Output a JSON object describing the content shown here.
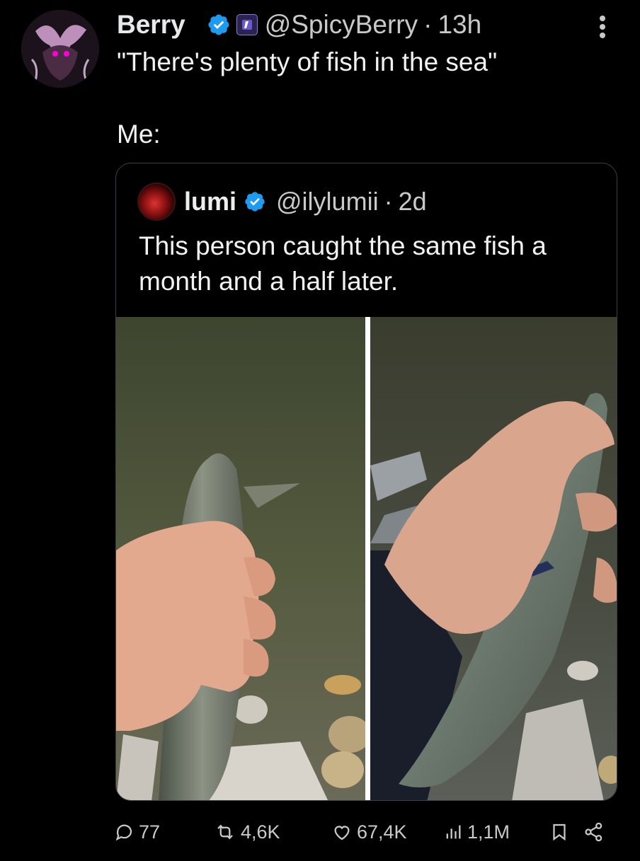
{
  "tweet": {
    "author_name": "Berry",
    "handle": "@SpicyBerry",
    "separator": "·",
    "time": "13h",
    "text_line1": "\"There's plenty of fish in the sea\"",
    "text_line2": "Me:",
    "icons": {
      "verified": "verified-badge-icon",
      "affiliate": "affiliate-badge-icon",
      "more": "more-vertical-icon"
    }
  },
  "quote": {
    "author_name": "lumi",
    "handle": "@ilylumii",
    "separator": "·",
    "time": "2d",
    "text": "This person caught the same fish a month and a half later."
  },
  "actions": {
    "replies": "77",
    "reposts": "4,6K",
    "likes": "67,4K",
    "views": "1,1M",
    "icons": [
      "reply-icon",
      "repost-icon",
      "like-icon",
      "views-icon",
      "bookmark-icon",
      "share-icon"
    ]
  },
  "colors": {
    "background": "#000000",
    "text": "#e7e9ea",
    "muted": "#c9c9c9",
    "verified": "#1d9bf0",
    "border": "#3c4045"
  }
}
